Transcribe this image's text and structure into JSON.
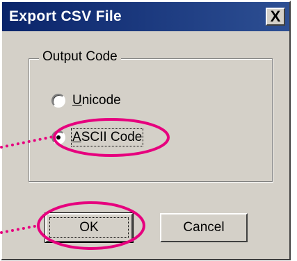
{
  "window": {
    "title": "Export CSV File",
    "close_label": "X"
  },
  "group": {
    "legend": "Output Code",
    "options": [
      {
        "mnemonic": "U",
        "rest": "nicode",
        "selected": false
      },
      {
        "mnemonic": "A",
        "rest": "SCII Code",
        "selected": true
      }
    ]
  },
  "buttons": {
    "ok": "OK",
    "cancel": "Cancel"
  },
  "annotations": {
    "highlight_color": "#e6007e",
    "targets": [
      "ASCII Code",
      "OK"
    ]
  }
}
